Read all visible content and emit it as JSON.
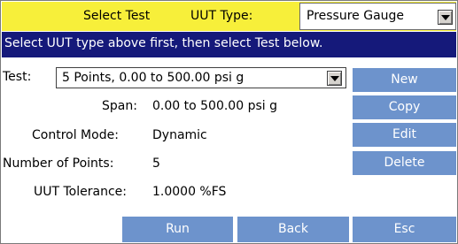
{
  "header": {
    "title": "Select Test",
    "uut_type_label": "UUT Type:",
    "uut_type_value": "Pressure Gauge",
    "bg_color": "#f7ef3a"
  },
  "instruction": "Select UUT type above first, then select Test below.",
  "test": {
    "label": "Test:",
    "selected": "5 Points, 0.00 to 500.00 psi g"
  },
  "fields": {
    "span_label": "Span:",
    "span_value": "0.00 to 500.00 psi g",
    "control_mode_label": "Control Mode:",
    "control_mode_value": "Dynamic",
    "num_points_label": "Number of Points:",
    "num_points_value": "5",
    "tolerance_label": "UUT Tolerance:",
    "tolerance_value": "1.0000 %FS"
  },
  "side_buttons": {
    "new": "New",
    "copy": "Copy",
    "edit": "Edit",
    "delete": "Delete"
  },
  "bottom_buttons": {
    "run": "Run",
    "back": "Back",
    "esc": "Esc"
  },
  "colors": {
    "button": "#6d93cc",
    "instruction_bar": "#15197a"
  }
}
